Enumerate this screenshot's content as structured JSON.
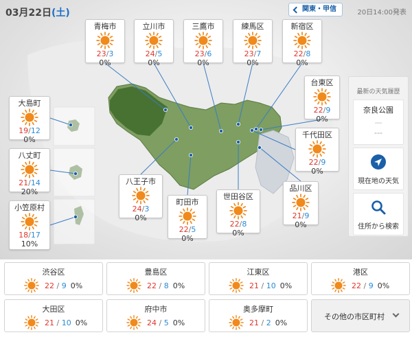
{
  "header": {
    "date": "03月22日",
    "dow_open": "(",
    "dow": "土",
    "dow_close": ")",
    "region_button": "関東・甲信",
    "announced": "20日14:00発表"
  },
  "colors": {
    "high_temp": "#e0352b",
    "low_temp": "#2a8ad6",
    "sun": "#f08a1c"
  },
  "map_cards": [
    {
      "name": "青梅市",
      "high": "23",
      "low": "3",
      "pop": "0%",
      "icon": "sunny-icon"
    },
    {
      "name": "立川市",
      "high": "24",
      "low": "5",
      "pop": "0%",
      "icon": "sunny-icon"
    },
    {
      "name": "三鷹市",
      "high": "23",
      "low": "6",
      "pop": "0%",
      "icon": "sunny-icon"
    },
    {
      "name": "練馬区",
      "high": "23",
      "low": "7",
      "pop": "0%",
      "icon": "sunny-icon"
    },
    {
      "name": "新宿区",
      "high": "22",
      "low": "8",
      "pop": "0%",
      "icon": "sunny-icon"
    },
    {
      "name": "台東区",
      "high": "22",
      "low": "9",
      "pop": "0%",
      "icon": "sunny-icon"
    },
    {
      "name": "千代田区",
      "high": "22",
      "low": "9",
      "pop": "0%",
      "icon": "sunny-icon"
    },
    {
      "name": "品川区",
      "high": "21",
      "low": "9",
      "pop": "0%",
      "icon": "sunny-icon"
    },
    {
      "name": "世田谷区",
      "high": "22",
      "low": "8",
      "pop": "0%",
      "icon": "sunny-icon"
    },
    {
      "name": "町田市",
      "high": "22",
      "low": "5",
      "pop": "0%",
      "icon": "sunny-icon"
    },
    {
      "name": "八王子市",
      "high": "24",
      "low": "3",
      "pop": "0%",
      "icon": "sunny-icon"
    },
    {
      "name": "大島町",
      "high": "19",
      "low": "12",
      "pop": "0%",
      "icon": "sunny-icon"
    },
    {
      "name": "八丈町",
      "high": "21",
      "low": "14",
      "pop": "20%",
      "icon": "sunny-icon"
    },
    {
      "name": "小笠原村",
      "high": "18",
      "low": "17",
      "pop": "10%",
      "icon": "sunny-icon"
    }
  ],
  "side_panel": {
    "title": "最新の天気履歴",
    "history_location": "奈良公園",
    "history_dash": "—",
    "history_value": "---",
    "current_location_label": "現在地の天気",
    "current_location_icon": "navigation-arrow-icon",
    "search_label": "住所から検索",
    "search_icon": "search-icon"
  },
  "bottom_grid": [
    {
      "name": "渋谷区",
      "high": "22",
      "low": "9",
      "pop": "0%"
    },
    {
      "name": "豊島区",
      "high": "22",
      "low": "8",
      "pop": "0%"
    },
    {
      "name": "江東区",
      "high": "21",
      "low": "10",
      "pop": "0%"
    },
    {
      "name": "港区",
      "high": "22",
      "low": "9",
      "pop": "0%"
    },
    {
      "name": "大田区",
      "high": "21",
      "low": "10",
      "pop": "0%"
    },
    {
      "name": "府中市",
      "high": "24",
      "low": "5",
      "pop": "0%"
    },
    {
      "name": "奥多摩町",
      "high": "21",
      "low": "2",
      "pop": "0%"
    }
  ],
  "more_label": "その他の市区町村",
  "separator": "/"
}
